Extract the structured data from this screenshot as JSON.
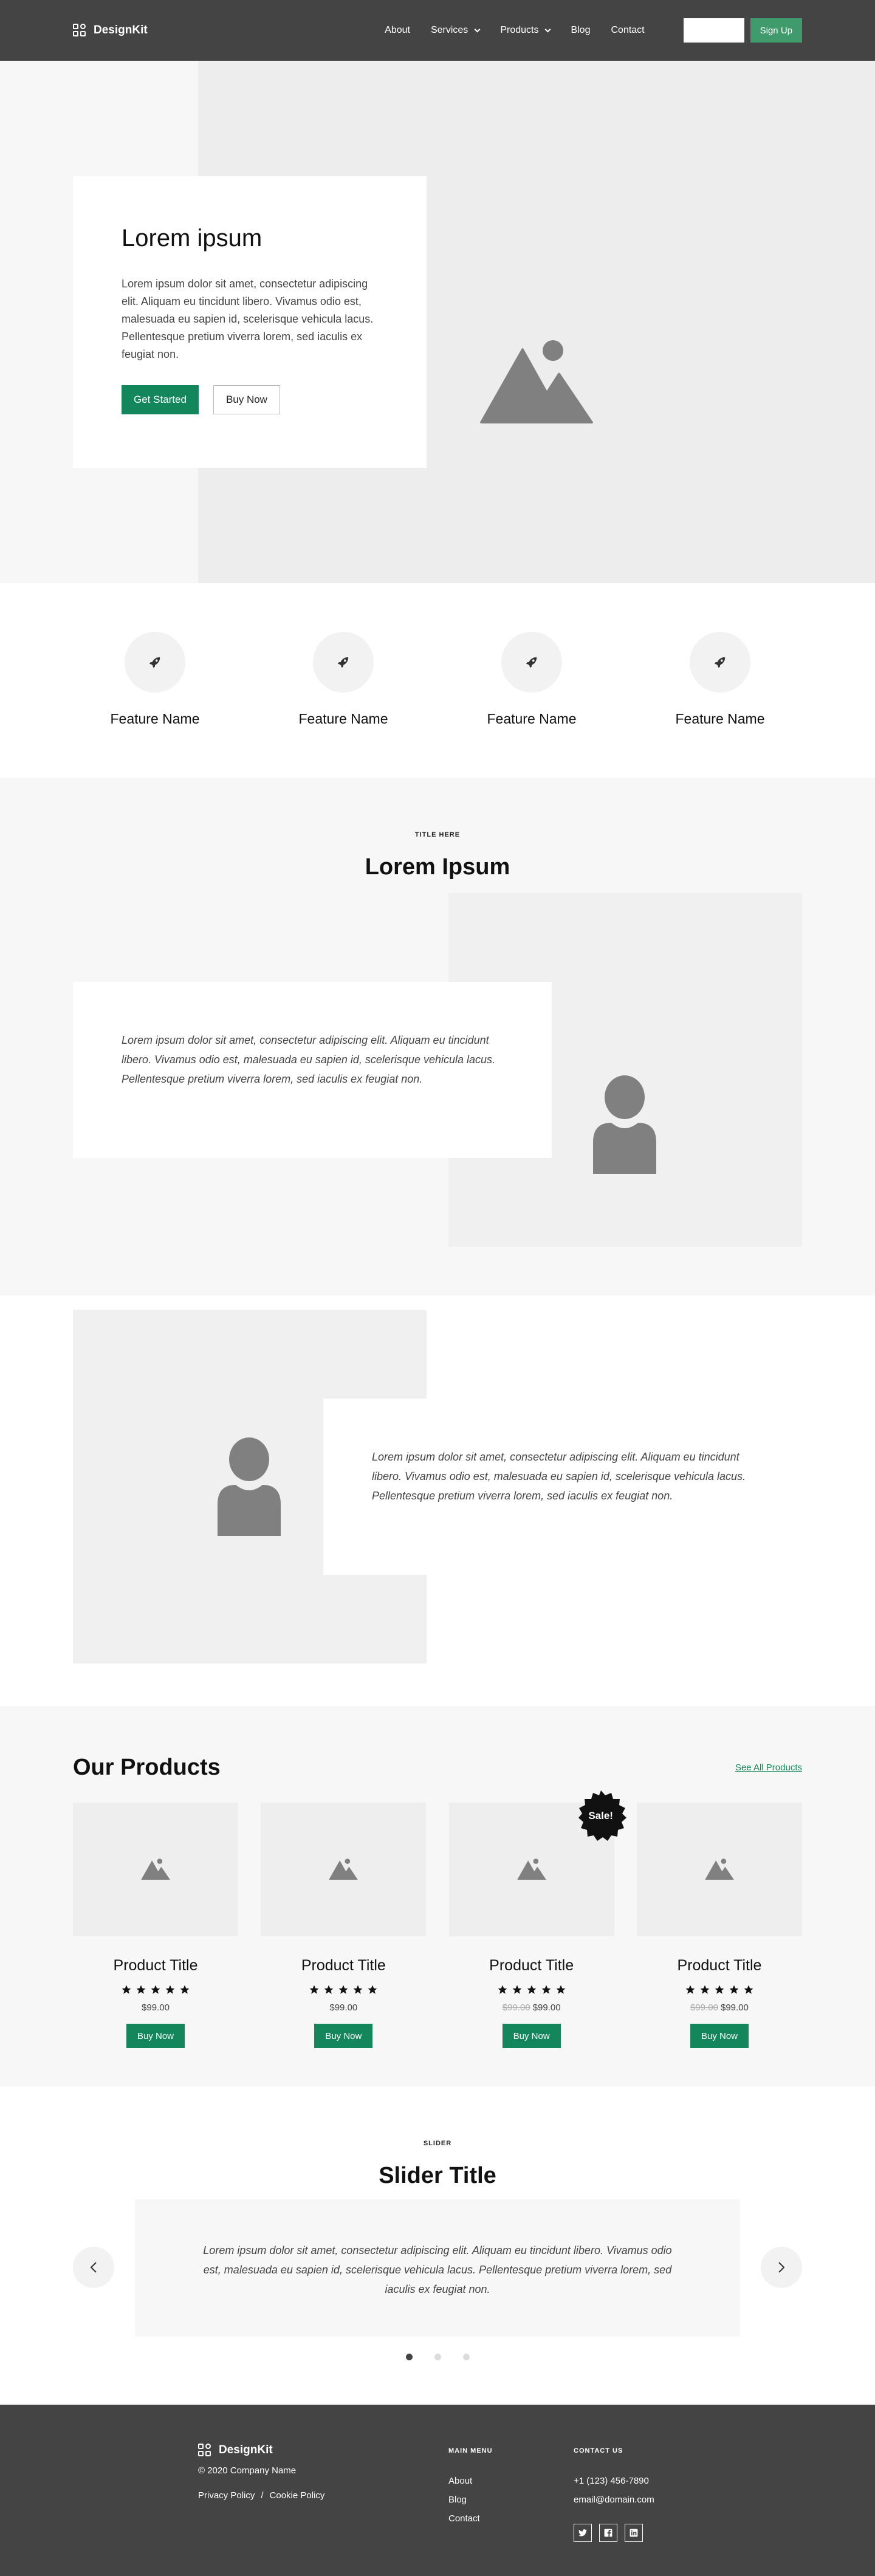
{
  "header": {
    "logo": "DesignKit",
    "nav": [
      {
        "label": "About",
        "dropdown": false
      },
      {
        "label": "Services",
        "dropdown": true
      },
      {
        "label": "Products",
        "dropdown": true
      },
      {
        "label": "Blog",
        "dropdown": false
      },
      {
        "label": "Contact",
        "dropdown": false
      }
    ],
    "signup": "Sign Up"
  },
  "hero": {
    "title": "Lorem ipsum",
    "text": "Lorem ipsum dolor sit amet, consectetur adipiscing elit. Aliquam eu tincidunt libero. Vivamus odio est, malesuada eu sapien id, scelerisque vehicula lacus. Pellentesque pretium viverra lorem, sed iaculis ex feugiat non.",
    "primary": "Get Started",
    "secondary": "Buy Now"
  },
  "features": [
    {
      "name": "Feature Name",
      "icon": "rocket-icon"
    },
    {
      "name": "Feature Name",
      "icon": "rocket-icon"
    },
    {
      "name": "Feature Name",
      "icon": "rocket-icon"
    },
    {
      "name": "Feature Name",
      "icon": "rocket-icon"
    }
  ],
  "testimonial": {
    "eyebrow": "TITLE HERE",
    "title": "Lorem Ipsum",
    "quote1": "Lorem ipsum dolor sit amet, consectetur adipiscing elit. Aliquam eu tincidunt libero. Vivamus odio est, malesuada eu sapien id, scelerisque vehicula lacus. Pellentesque pretium viverra lorem, sed iaculis ex feugiat non.",
    "quote2": "Lorem ipsum dolor sit amet, consectetur adipiscing elit. Aliquam eu tincidunt libero. Vivamus odio est, malesuada eu sapien id, scelerisque vehicula lacus. Pellentesque pretium viverra lorem, sed iaculis ex feugiat non."
  },
  "products": {
    "title": "Our Products",
    "see_all": "See All Products",
    "sale_badge": "Sale!",
    "items": [
      {
        "name": "Product Title",
        "rating": 5,
        "old_price": "",
        "price": "$99.00",
        "button": "Buy Now"
      },
      {
        "name": "Product Title",
        "rating": 5,
        "old_price": "",
        "price": "$99.00",
        "button": "Buy Now"
      },
      {
        "name": "Product Title",
        "rating": 5,
        "old_price": "$99.00",
        "price": "$99.00",
        "button": "Buy Now"
      },
      {
        "name": "Product Title",
        "rating": 5,
        "old_price": "$99.00",
        "price": "$99.00",
        "button": "Buy Now"
      }
    ]
  },
  "slider": {
    "eyebrow": "SLIDER",
    "title": "Slider Title",
    "text": "Lorem ipsum dolor sit amet, consectetur adipiscing elit. Aliquam eu tincidunt libero. Vivamus odio est, malesuada eu sapien id, scelerisque vehicula lacus. Pellentesque pretium viverra lorem, sed iaculis ex feugiat non.",
    "active_index": 0,
    "count": 3
  },
  "footer": {
    "logo": "DesignKit",
    "copyright": "© 2020 Company Name",
    "privacy": "Privacy Policy",
    "separator": "/",
    "cookie": "Cookie Policy",
    "menu_head": "MAIN MENU",
    "menu": [
      "About",
      "Blog",
      "Contact"
    ],
    "contact_head": "CONTACT US",
    "phone": "+1 (123) 456-7890",
    "email": "email@domain.com",
    "socials": [
      "twitter-icon",
      "facebook-icon",
      "linkedin-icon"
    ]
  },
  "colors": {
    "header_bg": "#444444",
    "accent": "#13875b",
    "signup_bg": "#3f9a6c"
  }
}
